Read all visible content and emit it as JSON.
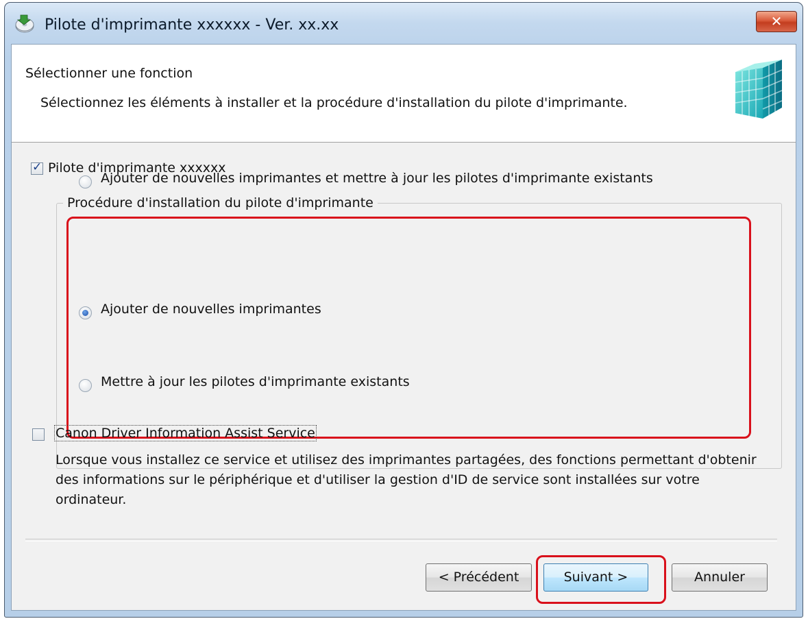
{
  "window": {
    "title": "Pilote d'imprimante xxxxxx - Ver. xx.xx",
    "close_label": "✕"
  },
  "header": {
    "title": "Sélectionner une fonction",
    "description": "Sélectionnez les éléments à installer et la procédure d'installation du pilote d'imprimante."
  },
  "driver_checkbox": {
    "label": "Pilote d'imprimante xxxxxx",
    "checked": true
  },
  "procedure_group": {
    "legend": "Procédure d'installation du pilote d'imprimante",
    "options": [
      {
        "label": "Ajouter de nouvelles imprimantes et mettre à jour les pilotes d'imprimante existants",
        "selected": false
      },
      {
        "label": "Ajouter de nouvelles imprimantes",
        "selected": true
      },
      {
        "label": "Mettre à jour les pilotes d'imprimante existants",
        "selected": false
      }
    ]
  },
  "service_checkbox": {
    "label": "Canon Driver Information Assist Service",
    "checked": false,
    "description": "Lorsque vous installez ce service et utilisez des imprimantes partagées, des fonctions permettant d'obtenir des informations sur le périphérique et d'utiliser la gestion d'ID de service sont installées sur votre ordinateur."
  },
  "buttons": {
    "back": "< Précédent",
    "next": "Suivant >",
    "cancel": "Annuler"
  },
  "colors": {
    "highlight": "#d9101b",
    "title_bar": "#c3d8ee",
    "close_button": "#c33d1f"
  }
}
